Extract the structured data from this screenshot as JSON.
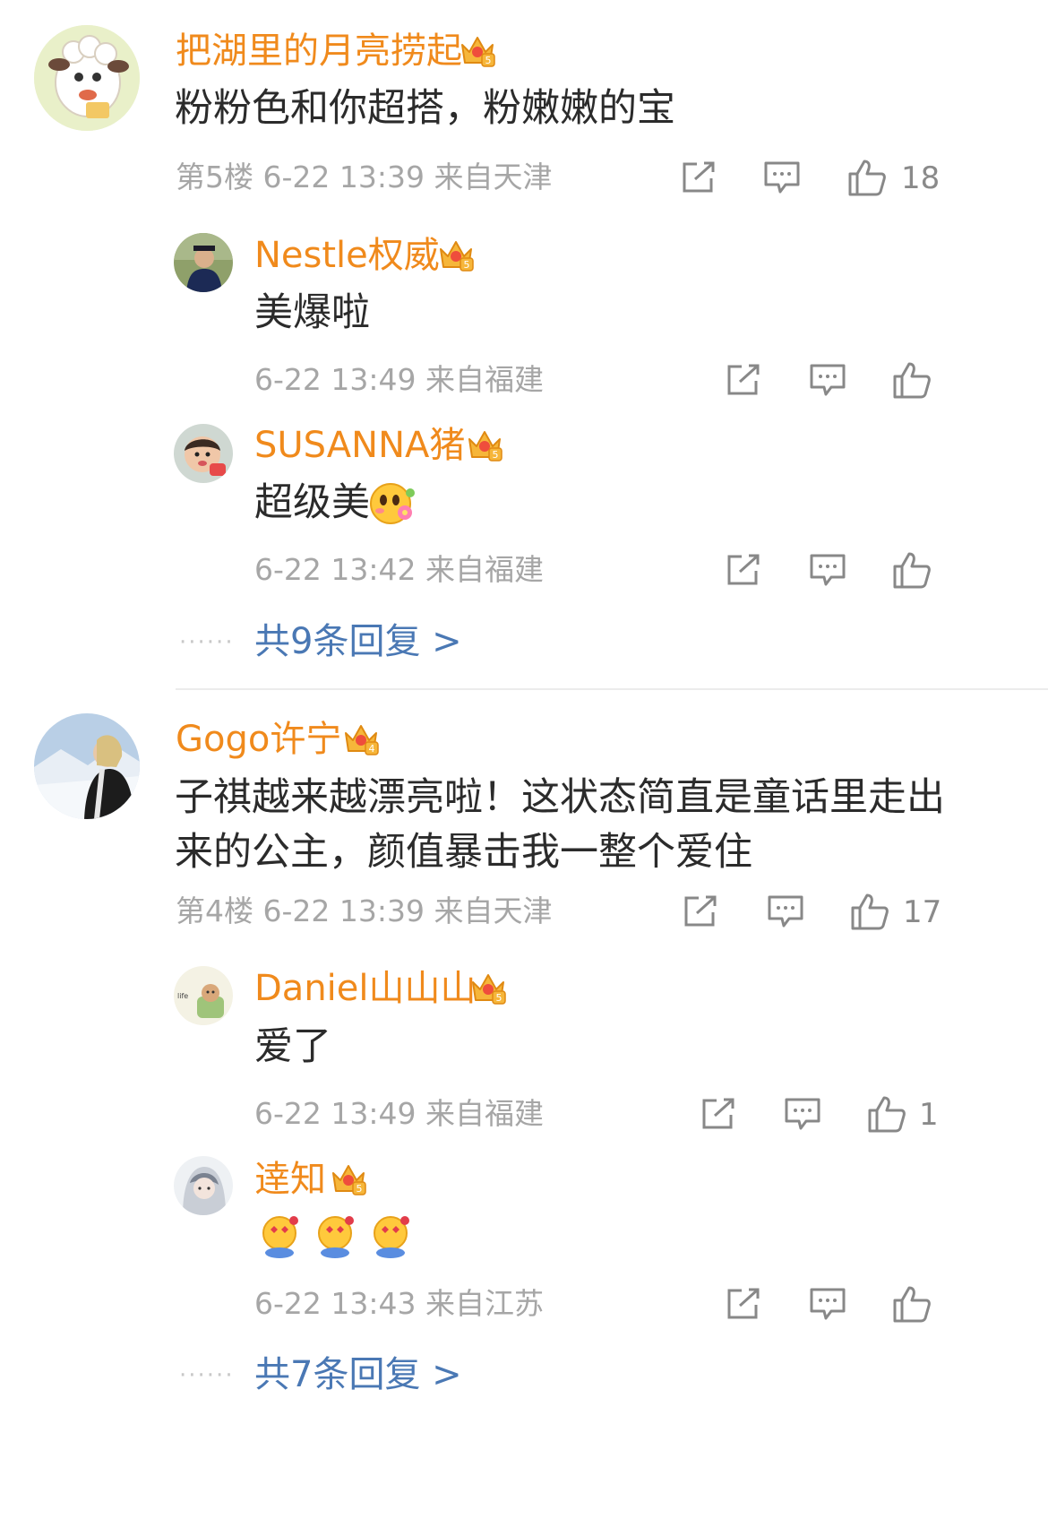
{
  "threads": [
    {
      "name": "把湖里的月亮捞起",
      "text": "粉粉色和你超搭，粉嫩嫩的宝",
      "floor": "第5楼",
      "time": "6-22 13:39",
      "location": "来自天津",
      "likes": "18",
      "crown_level": "5",
      "avatar": "sheep-cartoon-avatar",
      "replies": [
        {
          "name": "Nestle权威",
          "text": "美爆啦",
          "time": "6-22 13:49",
          "location": "来自福建",
          "likes": "",
          "crown_level": "5",
          "avatar": "graduate-photo-avatar"
        },
        {
          "name": "SUSANNA猪",
          "text": "超级美",
          "emoji": "flower-blush-emoji",
          "time": "6-22 13:42",
          "location": "来自福建",
          "likes": "",
          "crown_level": "5",
          "avatar": "baby-photo-avatar"
        }
      ],
      "more_replies": "共9条回复 >"
    },
    {
      "name": "Gogo许宁",
      "text_lines": [
        "子祺越来越漂亮啦！这状态简直是童话里走出",
        "来的公主，颜值暴击我一整个爱住"
      ],
      "floor": "第4楼",
      "time": "6-22 13:39",
      "location": "来自天津",
      "likes": "17",
      "crown_level": "4",
      "avatar": "snow-landscape-avatar",
      "replies": [
        {
          "name": "Daniel山山山",
          "text": "爱了",
          "time": "6-22 13:49",
          "location": "来自福建",
          "likes": "1",
          "crown_level": "5",
          "avatar": "cartoon-sofa-avatar"
        },
        {
          "name": "逹知",
          "text": "",
          "emoji": "heart-eyes-hug-emoji x3",
          "time": "6-22 13:43",
          "location": "来自江苏",
          "likes": "",
          "crown_level": "5",
          "avatar": "anime-character-avatar"
        }
      ],
      "more_replies": "共7条回复 >"
    }
  ],
  "dots": "······",
  "colors": {
    "name": "#f08a1c",
    "text": "#2b2b2b",
    "meta": "#a6a6a6",
    "link": "#4a78b4",
    "divider": "#ececec"
  },
  "icons": {
    "share": "share-icon",
    "comment": "comment-icon",
    "like": "thumbs-up-icon",
    "crown": "crown-badge-icon"
  }
}
